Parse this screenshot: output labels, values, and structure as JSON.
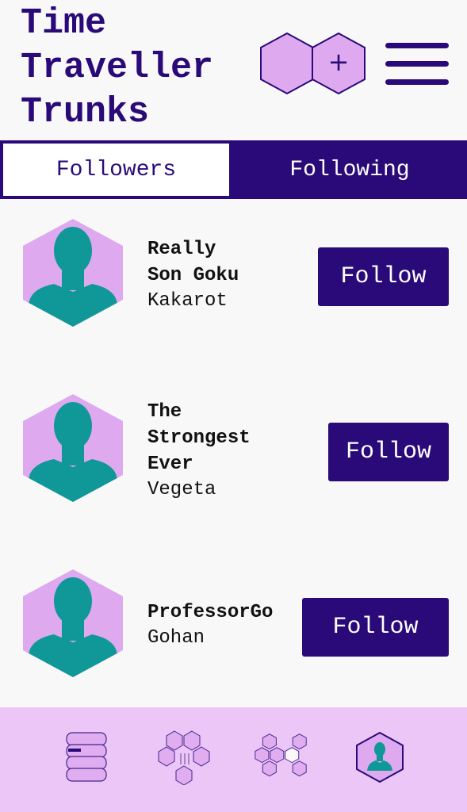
{
  "header": {
    "title_lines": [
      "Time",
      "Traveller",
      "Trunks"
    ],
    "plus_label": "+"
  },
  "tabs": [
    {
      "label": "Followers",
      "selected": false
    },
    {
      "label": "Following",
      "selected": true
    }
  ],
  "users": [
    {
      "tag": "Really\nSon Goku",
      "name": "Kakarot",
      "button": "Follow"
    },
    {
      "tag": "The\nStrongest\nEver",
      "name": "Vegeta",
      "button": "Follow"
    },
    {
      "tag": "ProfessorGo",
      "name": "Gohan",
      "button": "Follow"
    }
  ],
  "bottom_nav": [
    {
      "icon": "trunk-icon"
    },
    {
      "icon": "hex-cluster-icon"
    },
    {
      "icon": "hex-network-icon"
    },
    {
      "icon": "profile-icon",
      "active": true
    }
  ],
  "colors": {
    "primary": "#2a0a78",
    "accent_light": "#dea9ef",
    "avatar_figure": "#109898",
    "nav_background": "#ebc6f7",
    "page_background": "#f8f8f8"
  }
}
